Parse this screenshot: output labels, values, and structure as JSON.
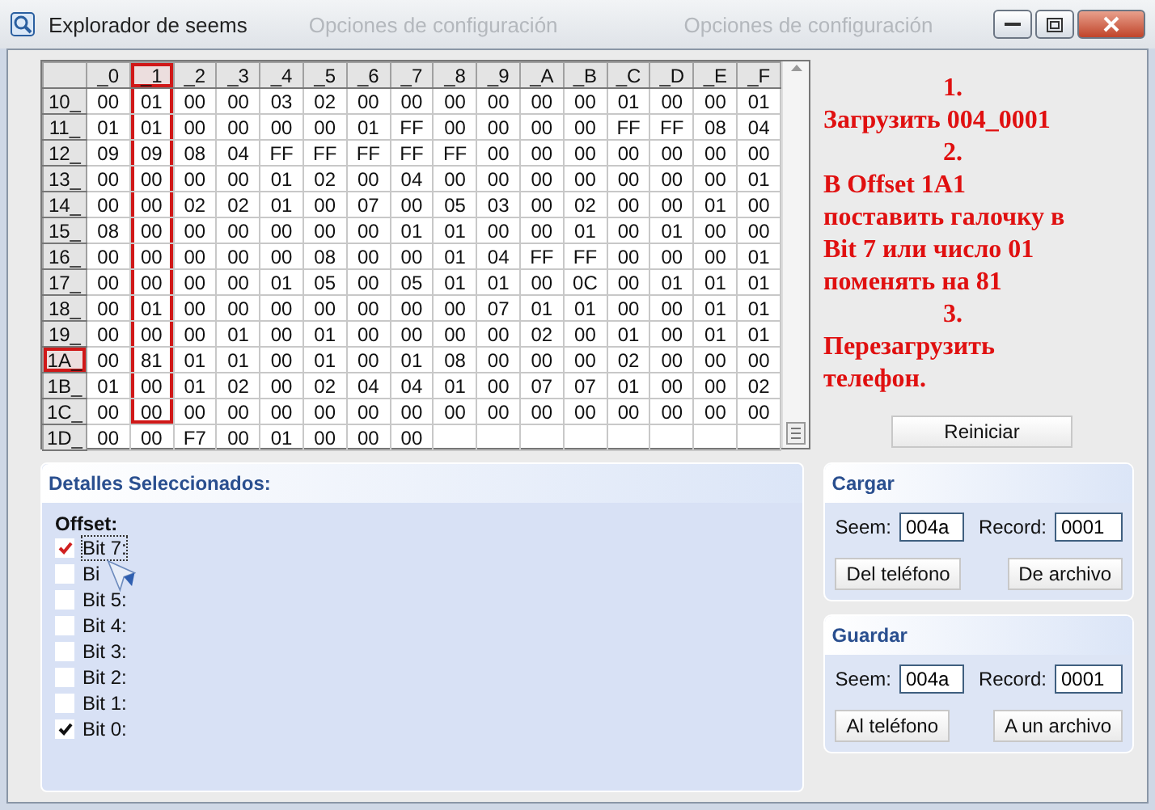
{
  "window": {
    "title": "Explorador de seems",
    "background_labels": [
      "Opciones de configuración",
      "Opciones de configuración"
    ]
  },
  "table": {
    "columns": [
      {
        "label": "_0",
        "selected": false
      },
      {
        "label": "_1",
        "selected": true
      },
      {
        "label": "_2",
        "selected": false
      },
      {
        "label": "_3",
        "selected": false
      },
      {
        "label": "_4",
        "selected": false
      },
      {
        "label": "_5",
        "selected": false
      },
      {
        "label": "_6",
        "selected": false
      },
      {
        "label": "_7",
        "selected": false
      },
      {
        "label": "_8",
        "selected": false
      },
      {
        "label": "_9",
        "selected": false
      },
      {
        "label": "_A",
        "selected": false
      },
      {
        "label": "_B",
        "selected": false
      },
      {
        "label": "_C",
        "selected": false
      },
      {
        "label": "_D",
        "selected": false
      },
      {
        "label": "_E",
        "selected": false
      },
      {
        "label": "_F",
        "selected": false
      }
    ],
    "rows": [
      {
        "label": "10_",
        "selected": false,
        "cells": [
          "00",
          "01",
          "00",
          "00",
          "03",
          "02",
          "00",
          "00",
          "00",
          "00",
          "00",
          "00",
          "01",
          "00",
          "00",
          "01"
        ]
      },
      {
        "label": "11_",
        "selected": false,
        "cells": [
          "01",
          "01",
          "00",
          "00",
          "00",
          "00",
          "01",
          "FF",
          "00",
          "00",
          "00",
          "00",
          "FF",
          "FF",
          "08",
          "04"
        ]
      },
      {
        "label": "12_",
        "selected": false,
        "cells": [
          "09",
          "09",
          "08",
          "04",
          "FF",
          "FF",
          "FF",
          "FF",
          "FF",
          "00",
          "00",
          "00",
          "00",
          "00",
          "00",
          "00"
        ]
      },
      {
        "label": "13_",
        "selected": false,
        "cells": [
          "00",
          "00",
          "00",
          "00",
          "01",
          "02",
          "00",
          "04",
          "00",
          "00",
          "00",
          "00",
          "00",
          "00",
          "00",
          "01"
        ]
      },
      {
        "label": "14_",
        "selected": false,
        "cells": [
          "00",
          "00",
          "02",
          "02",
          "01",
          "00",
          "07",
          "00",
          "05",
          "03",
          "00",
          "02",
          "00",
          "00",
          "01",
          "00"
        ]
      },
      {
        "label": "15_",
        "selected": false,
        "cells": [
          "08",
          "00",
          "00",
          "00",
          "00",
          "00",
          "00",
          "01",
          "01",
          "00",
          "00",
          "01",
          "00",
          "01",
          "00",
          "00"
        ]
      },
      {
        "label": "16_",
        "selected": false,
        "cells": [
          "00",
          "00",
          "00",
          "00",
          "00",
          "08",
          "00",
          "00",
          "01",
          "04",
          "FF",
          "FF",
          "00",
          "00",
          "00",
          "01"
        ]
      },
      {
        "label": "17_",
        "selected": false,
        "cells": [
          "00",
          "00",
          "00",
          "00",
          "01",
          "05",
          "00",
          "05",
          "01",
          "01",
          "00",
          "0C",
          "00",
          "01",
          "01",
          "01"
        ]
      },
      {
        "label": "18_",
        "selected": false,
        "cells": [
          "00",
          "01",
          "00",
          "00",
          "00",
          "00",
          "00",
          "00",
          "00",
          "07",
          "01",
          "01",
          "00",
          "00",
          "01",
          "01"
        ]
      },
      {
        "label": "19_",
        "selected": false,
        "cells": [
          "00",
          "00",
          "00",
          "01",
          "00",
          "01",
          "00",
          "00",
          "00",
          "00",
          "02",
          "00",
          "01",
          "00",
          "01",
          "01"
        ]
      },
      {
        "label": "1A_",
        "selected": true,
        "cells": [
          "00",
          "81",
          "01",
          "01",
          "00",
          "01",
          "00",
          "01",
          "08",
          "00",
          "00",
          "00",
          "02",
          "00",
          "00",
          "00"
        ]
      },
      {
        "label": "1B_",
        "selected": false,
        "cells": [
          "01",
          "00",
          "01",
          "02",
          "00",
          "02",
          "04",
          "04",
          "01",
          "00",
          "07",
          "07",
          "01",
          "00",
          "00",
          "02"
        ]
      },
      {
        "label": "1C_",
        "selected": false,
        "cells": [
          "00",
          "00",
          "00",
          "00",
          "00",
          "00",
          "00",
          "00",
          "00",
          "00",
          "00",
          "00",
          "00",
          "00",
          "00",
          "00"
        ]
      },
      {
        "label": "1D_",
        "selected": false,
        "cells": [
          "00",
          "00",
          "F7",
          "00",
          "01",
          "00",
          "00",
          "00"
        ]
      }
    ]
  },
  "instructions": [
    {
      "number": "1.",
      "text": "Загрузить 004_0001"
    },
    {
      "number": "2.",
      "text": "В Offset 1A1 поставить галочку в Bit 7 или  число 01 поменять на 81"
    },
    {
      "number": "3.",
      "text": "Перезагрузить телефон."
    }
  ],
  "reset_button": "Reiniciar",
  "details": {
    "title": "Detalles Seleccionados:",
    "offset_label": "Offset:",
    "bits": [
      {
        "label": "Bit 7:",
        "checked": true,
        "focused": true
      },
      {
        "label": "Bi",
        "checked": false,
        "focused": false
      },
      {
        "label": "Bit 5:",
        "checked": false,
        "focused": false
      },
      {
        "label": "Bit 4:",
        "checked": false,
        "focused": false
      },
      {
        "label": "Bit 3:",
        "checked": false,
        "focused": false
      },
      {
        "label": "Bit 2:",
        "checked": false,
        "focused": false
      },
      {
        "label": "Bit 1:",
        "checked": false,
        "focused": false
      },
      {
        "label": "Bit 0:",
        "checked": true,
        "focused": false
      }
    ]
  },
  "panels": [
    {
      "title": "Cargar",
      "seem_label": "Seem:",
      "seem": "004a",
      "record_label": "Record:",
      "record": "0001",
      "buttons": [
        "Del teléfono",
        "De archivo"
      ]
    },
    {
      "title": "Guardar",
      "seem_label": "Seem:",
      "seem": "004a",
      "record_label": "Record:",
      "record": "0001",
      "buttons": [
        "Al teléfono",
        "A un archivo"
      ]
    }
  ]
}
